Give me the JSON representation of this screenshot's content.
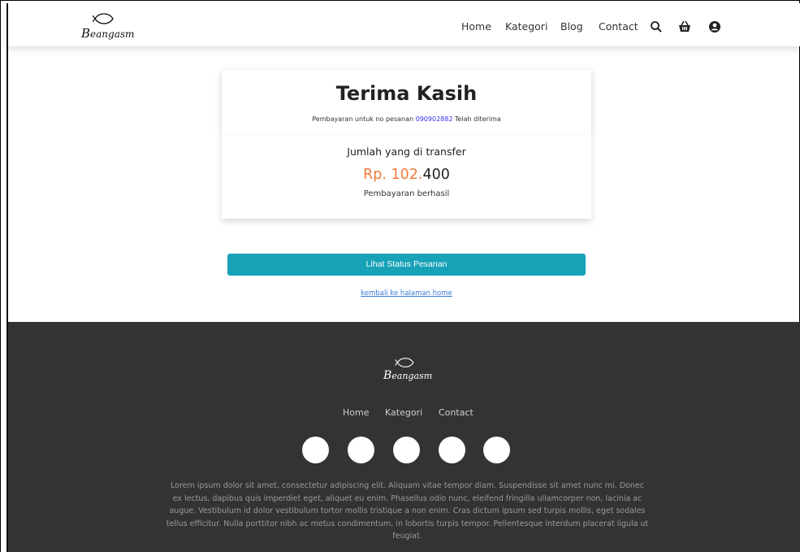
{
  "header": {
    "logo_text": "Beangasm",
    "nav": [
      {
        "label": "Home"
      },
      {
        "label": "Kategori"
      },
      {
        "label": "Blog"
      },
      {
        "label": "Contact"
      }
    ],
    "icons": [
      "search-icon",
      "basket-icon",
      "user-icon"
    ]
  },
  "receipt": {
    "title": "Terima Kasih",
    "subtitle_prefix": "Pembayaran untuk no pesanan",
    "order_number": "090902882",
    "subtitle_suffix": "Telah diterima",
    "amount_title": "Jumlah yang di transfer",
    "amount_main": "Rp. 102.",
    "amount_tail": "400",
    "status": "Pembayaran berhasil"
  },
  "actions": {
    "status_button": "Lihat Status Pesanan",
    "home_link": "kembali ke halaman home"
  },
  "footer": {
    "logo_text": "Beangasm",
    "nav": [
      {
        "label": "Home"
      },
      {
        "label": "Kategori"
      },
      {
        "label": "Contact"
      }
    ],
    "social_icons": [
      "social-icon-1",
      "social-icon-2",
      "social-icon-3",
      "social-icon-4",
      "social-icon-5"
    ],
    "description": "Lorem ipsum dolor sit amet, consectetur adipiscing elit. Aliquam vitae tempor diam. Suspendisse sit amet nunc mi. Donec ex lectus, dapibus quis imperdiet eget, aliquet eu enim. Phasellus odio nunc, eleifend fringilla ullamcorper non, lacinia ac augue. Vestibulum id dolor vestibulum tortor mollis tristique a non enim. Cras dictum ipsum sed turpis mollis, eget sodales tellus efficitur. Nulla porttitor nibh ac metus condimentum, in lobortis turpis tempor. Pellentesque interdum placerat ligula ut feugiat."
  },
  "colors": {
    "accent_button": "#17a2b8",
    "amount_highlight": "#f07a3a",
    "order_link": "#3333ee",
    "footer_bg": "#333333"
  }
}
